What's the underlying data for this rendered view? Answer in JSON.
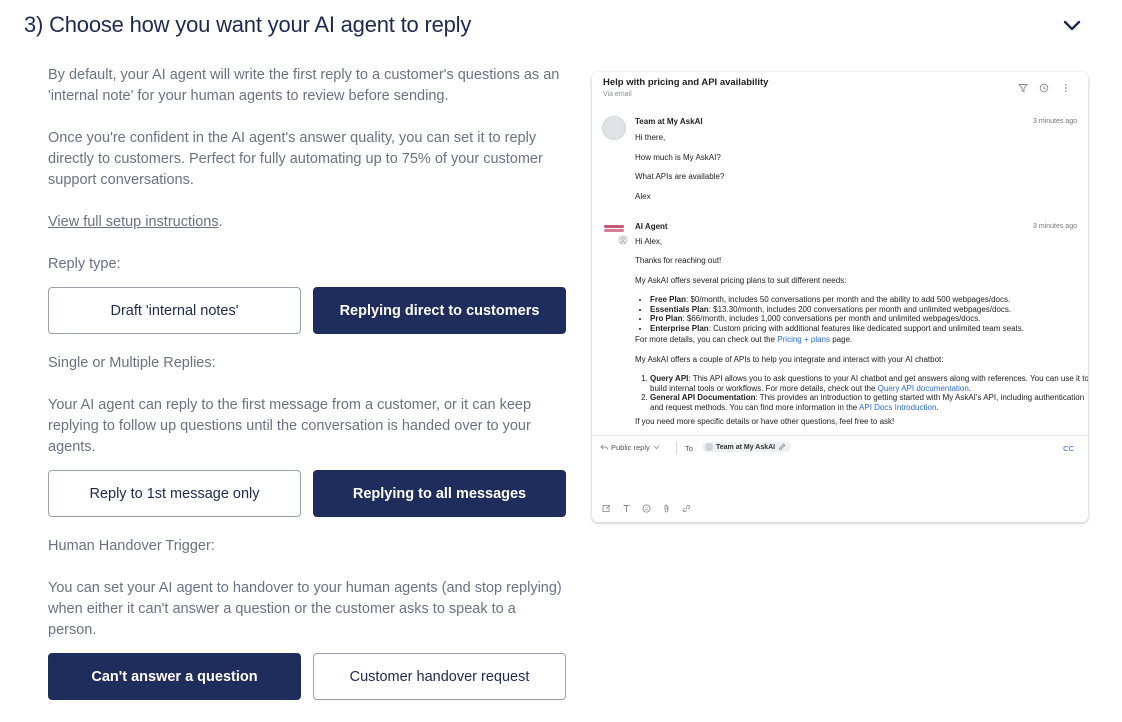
{
  "section": {
    "title": "3) Choose how you want your AI agent to reply"
  },
  "intro": {
    "para1": "By default, your AI agent will write the first reply to a customer's questions as an 'internal note' for your human agents to review before sending.",
    "para2": "Once you're confident in the AI agent's answer quality, you can set it to reply directly to customers. Perfect for fully automating up to 75% of your customer support conversations.",
    "link": "View full setup instructions",
    "link_suffix": "."
  },
  "reply_type": {
    "label": "Reply type:",
    "option_draft": "Draft 'internal notes'",
    "option_direct": "Replying direct to customers",
    "selected": "Replying direct to customers"
  },
  "replies": {
    "label": "Single or Multiple Replies:",
    "description": "Your AI agent can reply to the first message from a customer, or it can keep replying to follow up questions until the conversation is handed over to your agents.",
    "option_first": "Reply to 1st message only",
    "option_all": "Replying to all messages",
    "selected": "Replying to all messages"
  },
  "handover": {
    "label": "Human Handover Trigger:",
    "description": "You can set your AI agent to handover to your human agents (and stop replying) when either it can't answer a question or the customer asks to speak to a person.",
    "option_cant_answer": "Can't answer a question",
    "option_request": "Customer handover request",
    "selected": "Can't answer a question"
  },
  "colors": {
    "navy": "#1f2d5c",
    "muted_text": "#6b7283",
    "link_blue": "#2a6ae0",
    "ai_brand": "#c8557a"
  },
  "preview": {
    "subject": "Help with pricing and API availability",
    "via": "Via email",
    "icons": [
      "filter-icon",
      "history-icon",
      "more-icon"
    ],
    "message1": {
      "sender": "Team at My AskAI",
      "time": "3 minutes ago",
      "lines": [
        "Hi there,",
        "How much is My AskAI?",
        "What APIs are available?",
        "Alex"
      ]
    },
    "message2": {
      "sender": "AI Agent",
      "time": "3 minutes ago",
      "greeting": "Hi Alex,",
      "thanks": "Thanks for reaching out!",
      "plans_intro": "My AskAI offers several pricing plans to suit different needs:",
      "plans": [
        {
          "name": "Free Plan",
          "text": ": $0/month, includes 50 conversations per month and the ability to add 500 webpages/docs."
        },
        {
          "name": "Essentials Plan",
          "text": ": $13.30/month, includes 200 conversations per month and unlimited webpages/docs."
        },
        {
          "name": "Pro Plan",
          "text": ": $66/month, includes 1,000 conversations per month and unlimited webpages/docs."
        },
        {
          "name": "Enterprise Plan",
          "text": ": Custom pricing with additional features like dedicated support and unlimited team seats."
        }
      ],
      "details_prefix": "For more details, you can check out the ",
      "details_link": "Pricing + plans",
      "details_suffix": " page.",
      "apis_intro": "My AskAI offers a couple of APIs to help you integrate and interact with your AI chatbot:",
      "apis": [
        {
          "name": "Query API",
          "text": ": This API allows you to ask questions to your AI chatbot and get answers along with references. You can use it to build internal tools or workflows. For more details, check out the ",
          "link": "Query API documentation",
          "suffix": "."
        },
        {
          "name": "General API Documentation",
          "text": ": This provides an introduction to getting started with My AskAI's API, including authentication and request methods. You can find more information in the ",
          "link": "API Docs Introduction",
          "suffix": "."
        }
      ],
      "closing": "If you need more specific details or have other questions, feel free to ask!"
    },
    "composer": {
      "reply_mode": "Public reply",
      "to_label": "To",
      "recipient": "Team at My AskAI",
      "cc": "CC",
      "tools": [
        "compose-icon",
        "text-format-icon",
        "emoji-icon",
        "attachment-icon",
        "link-icon"
      ]
    }
  }
}
